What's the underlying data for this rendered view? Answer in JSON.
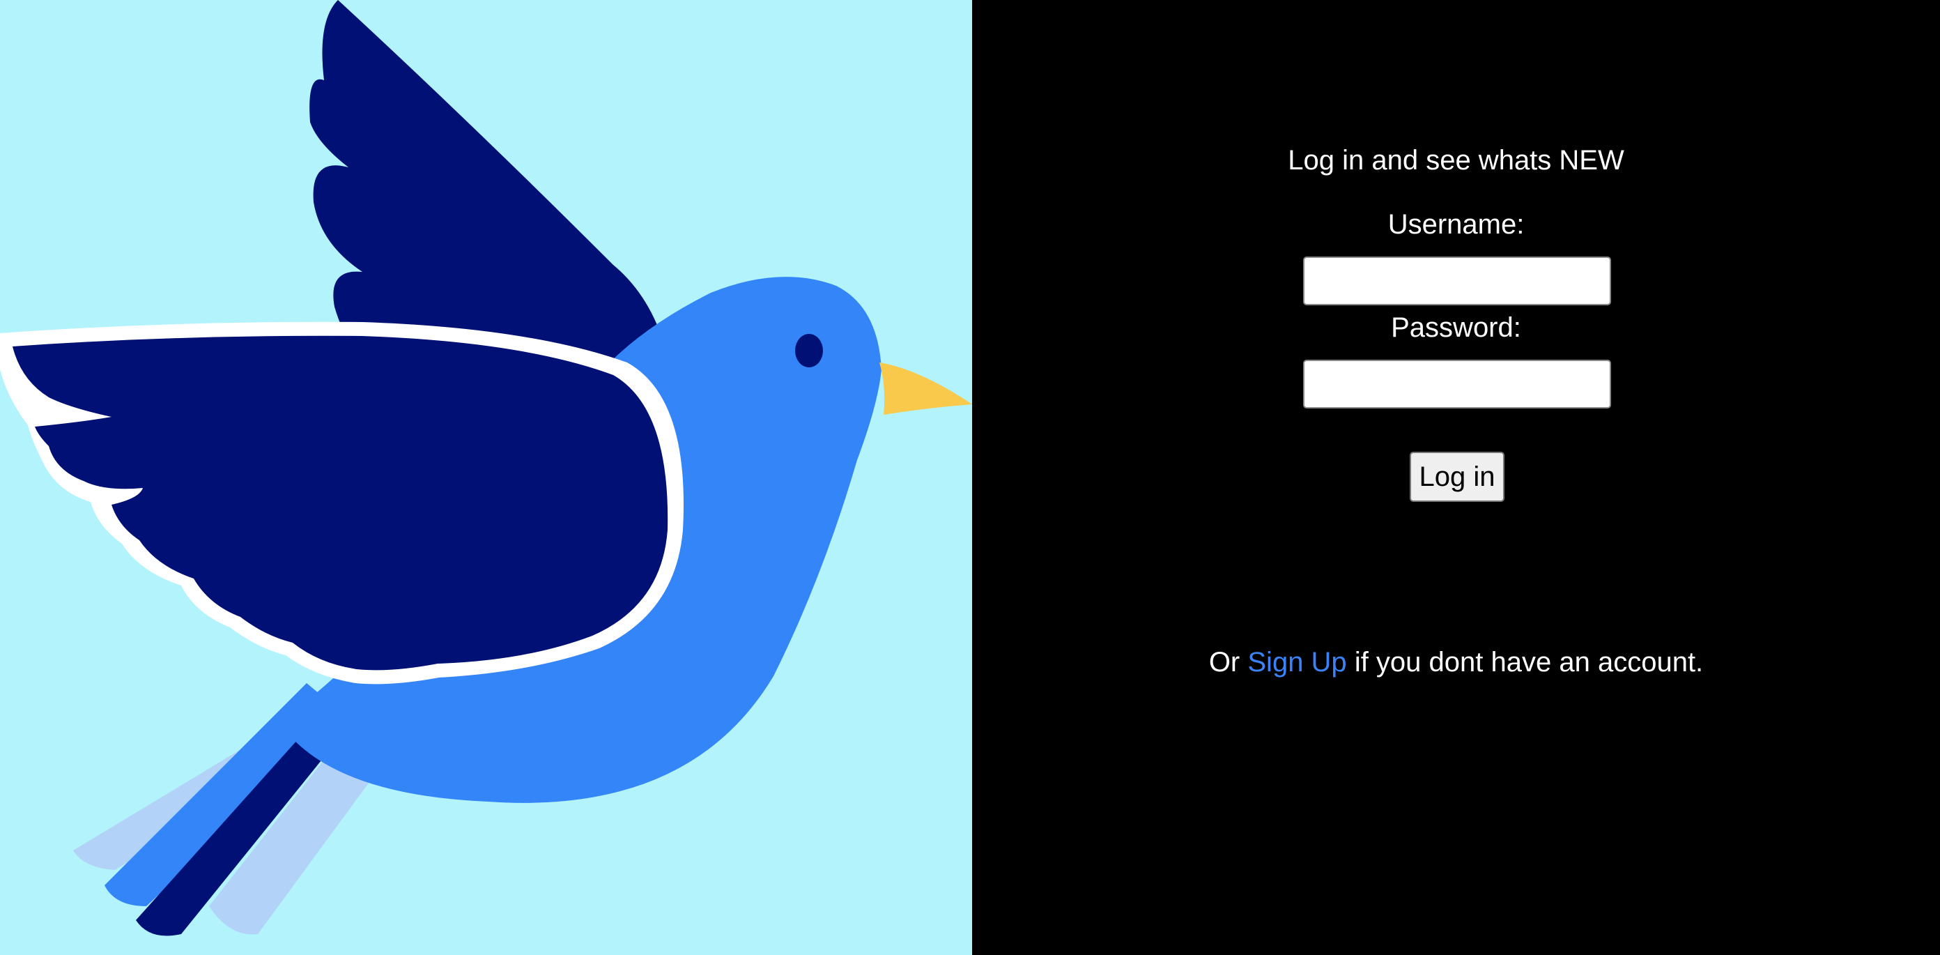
{
  "login": {
    "heading": "Log in and see whats NEW",
    "username_label": "Username:",
    "username_value": "",
    "password_label": "Password:",
    "password_value": "",
    "submit_label": "Log in"
  },
  "signup": {
    "prefix": "Or",
    "link_label": "Sign Up",
    "suffix": "if you dont have an account."
  },
  "icons": {
    "hero": "bird-illustration"
  },
  "colors": {
    "hero_background": "#b3f3fb",
    "panel_background": "#000000",
    "text": "#ffffff",
    "link": "#3b82f6",
    "bird_body": "#3485f7",
    "bird_wing": "#001074",
    "bird_beak": "#f8c94a"
  }
}
